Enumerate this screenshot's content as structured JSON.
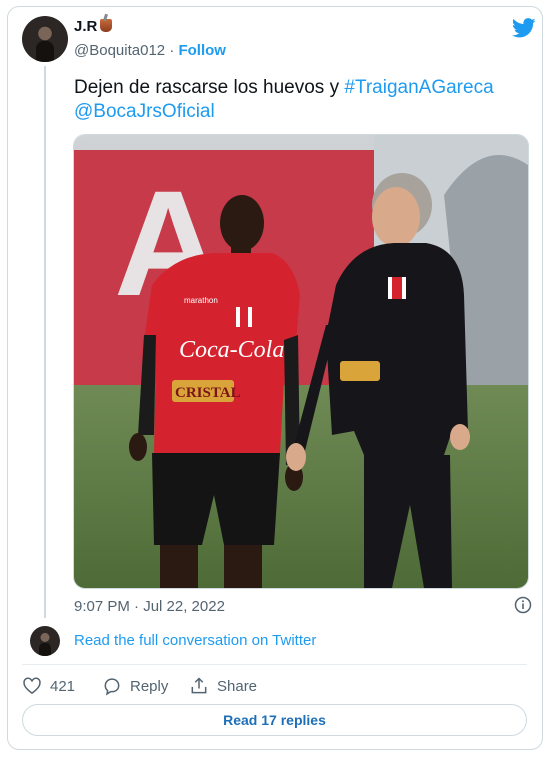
{
  "author": {
    "name": "J.R",
    "handle": "@Boquita012",
    "follow_label": "Follow"
  },
  "tweet": {
    "text": "Dejen de rascarse los huevos y ",
    "hashtag": "#TraiganAGareca",
    "mention": "@BocaJrsOficial",
    "timestamp": "9:07 PM · Jul 22, 2022"
  },
  "photo": {
    "banner_letter": "A",
    "shirt_sponsor": "Coca-Cola",
    "shirt_brand": "CRISTAL",
    "kit_maker": "marathon"
  },
  "conversation": {
    "link_label": "Read the full conversation on Twitter"
  },
  "actions": {
    "like_count": "421",
    "reply_label": "Reply",
    "share_label": "Share"
  },
  "replies_button": "Read 17 replies",
  "colors": {
    "accent": "#1d9bf0",
    "text": "#0f1419",
    "muted": "#536471",
    "border": "#cfd9de"
  }
}
